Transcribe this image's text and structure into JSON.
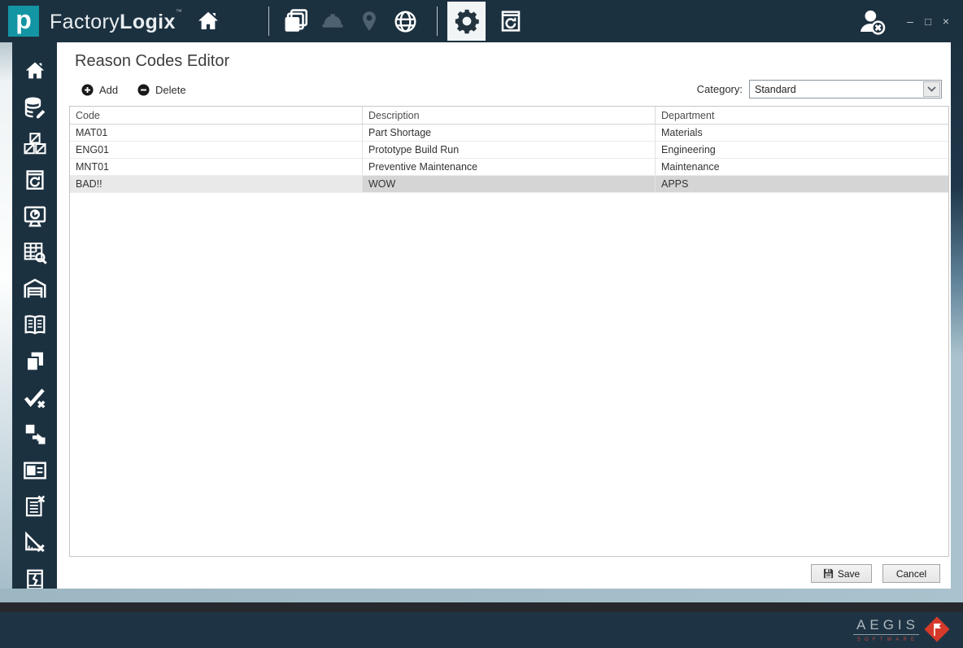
{
  "topbar": {
    "logo_letter": "p",
    "brand_light": "Factory",
    "brand_bold": "Logix",
    "trademark": "™",
    "icons": [
      "home-icon",
      "documents-icon",
      "hardhat-icon",
      "location-pin-icon",
      "globe-icon",
      "gear-icon",
      "database-backup-icon",
      "user-remove-icon"
    ],
    "selected_icon": "gear-icon"
  },
  "window_controls": {
    "minimize": "–",
    "maximize": "□",
    "close": "×"
  },
  "sidebar": {
    "items": [
      "home",
      "database-edit",
      "material-blocks",
      "database-backup",
      "dashboard-monitor",
      "table-search",
      "warehouse",
      "open-book",
      "documents",
      "pass-fail",
      "transfer",
      "id-card",
      "checklist-remove",
      "measure-remove",
      "defect-document"
    ]
  },
  "main": {
    "title": "Reason Codes Editor",
    "toolbar": {
      "add": "Add",
      "delete": "Delete",
      "category_label": "Category:",
      "category_value": "Standard"
    },
    "table": {
      "columns": [
        "Code",
        "Description",
        "Department"
      ],
      "rows": [
        {
          "code": "MAT01",
          "description": "Part Shortage",
          "department": "Materials",
          "selected": false
        },
        {
          "code": "ENG01",
          "description": "Prototype Build Run",
          "department": "Engineering",
          "selected": false
        },
        {
          "code": "MNT01",
          "description": "Preventive Maintenance",
          "department": "Maintenance",
          "selected": false
        },
        {
          "code": "BAD!!",
          "description": "WOW",
          "department": "APPS",
          "selected": true
        }
      ]
    },
    "buttons": {
      "save": "Save",
      "cancel": "Cancel"
    }
  },
  "footer": {
    "brand": "AEGIS",
    "brand_sub": "SOFTWARE"
  },
  "colors": {
    "bar_navy": "#1c3140",
    "logo_teal": "#1495a3",
    "muted_icon": "#4e6170",
    "selected_tab_bg": "#f2f5f6",
    "selected_row": "#d5d5d5",
    "frame_blue": "#a3bcc8",
    "footer_band": "#26292d",
    "footer_navy": "#1e3444",
    "aegis_red": "#d63a2a"
  }
}
